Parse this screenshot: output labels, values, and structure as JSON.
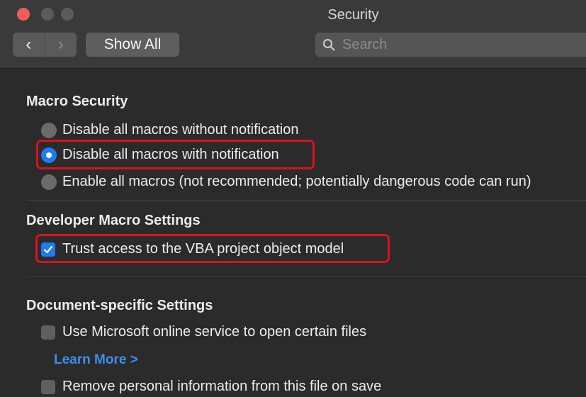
{
  "window": {
    "title": "Security"
  },
  "toolbar": {
    "back_glyph": "‹",
    "forward_glyph": "›",
    "show_all_label": "Show All",
    "search_placeholder": "Search"
  },
  "macro_security": {
    "title": "Macro Security",
    "options": [
      {
        "label": "Disable all macros without notification",
        "selected": false
      },
      {
        "label": "Disable all macros with notification",
        "selected": true
      },
      {
        "label": "Enable all macros (not recommended; potentially dangerous code can run)",
        "selected": false
      }
    ]
  },
  "developer_macro_settings": {
    "title": "Developer Macro Settings",
    "trust_vba_label": "Trust access to the VBA project object model",
    "trust_vba_checked": true
  },
  "document_specific_settings": {
    "title": "Document-specific Settings",
    "online_service_label": "Use Microsoft online service to open certain files",
    "online_service_checked": false,
    "learn_more_label": "Learn More >",
    "remove_personal_label": "Remove personal information from this file on save",
    "remove_personal_checked": false
  },
  "colors": {
    "accent": "#1d7cf2",
    "highlight": "#d8121b",
    "link": "#3b8ff0"
  }
}
